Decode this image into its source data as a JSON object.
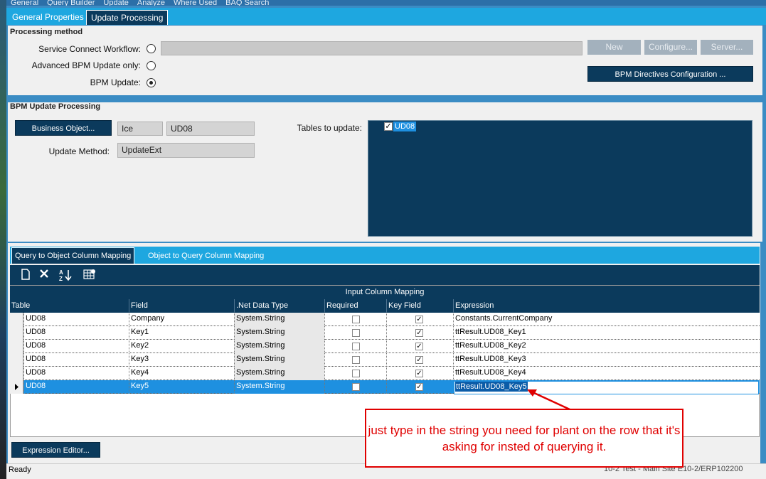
{
  "top_menu": [
    "General",
    "Query Builder",
    "Update",
    "Analyze",
    "Where Used",
    "BAQ Search"
  ],
  "tabs": [
    {
      "label": "General Properties",
      "active": false
    },
    {
      "label": "Update  Processing",
      "active": true
    }
  ],
  "processing_method": {
    "title": "Processing method",
    "options": [
      {
        "label": "Service Connect Workflow:",
        "selected": false
      },
      {
        "label": "Advanced BPM Update only:",
        "selected": false
      },
      {
        "label": "BPM Update:",
        "selected": true
      }
    ],
    "workflow_value": "",
    "buttons": {
      "new": "New",
      "configure": "Configure...",
      "server": "Server..."
    },
    "bpm_directives_button": "BPM Directives Configuration ..."
  },
  "bpm_update_processing": {
    "title": "BPM Update Processing",
    "business_object_button": "Business Object...",
    "bo_system": "Ice",
    "bo_name": "UD08",
    "update_method_label": "Update Method:",
    "update_method_value": "UpdateExt",
    "tables_label": "Tables to update:",
    "tables": [
      {
        "name": "UD08",
        "checked": true
      }
    ]
  },
  "mapping_tabs": [
    {
      "label": "Query to Object Column Mapping",
      "active": true
    },
    {
      "label": "Object to Query Column Mapping",
      "active": false
    }
  ],
  "toolbar_icons": [
    "new-icon",
    "delete-icon",
    "sort-icon",
    "grid-settings-icon"
  ],
  "grid": {
    "title": "Input Column Mapping",
    "columns": [
      "Table",
      "Field",
      ".Net Data Type",
      "Required",
      "Key Field",
      "Expression"
    ],
    "rows": [
      {
        "table": "UD08",
        "field": "Company",
        "type": "System.String",
        "required": false,
        "key": true,
        "expression": "Constants.CurrentCompany",
        "selected": false
      },
      {
        "table": "UD08",
        "field": "Key1",
        "type": "System.String",
        "required": false,
        "key": true,
        "expression": "ttResult.UD08_Key1",
        "selected": false
      },
      {
        "table": "UD08",
        "field": "Key2",
        "type": "System.String",
        "required": false,
        "key": true,
        "expression": "ttResult.UD08_Key2",
        "selected": false
      },
      {
        "table": "UD08",
        "field": "Key3",
        "type": "System.String",
        "required": false,
        "key": true,
        "expression": "ttResult.UD08_Key3",
        "selected": false
      },
      {
        "table": "UD08",
        "field": "Key4",
        "type": "System.String",
        "required": false,
        "key": true,
        "expression": "ttResult.UD08_Key4",
        "selected": false
      },
      {
        "table": "UD08",
        "field": "Key5",
        "type": "System.String",
        "required": false,
        "key": true,
        "expression": "ttResult.UD08_Key5",
        "selected": true
      }
    ]
  },
  "expression_editor_button": "Expression Editor...",
  "status": {
    "left": "Ready",
    "right": "10-2 Test - Main Site   E10-2/ERP102200"
  },
  "annotation": "just type in the string you need for plant on the row that it's asking for insted of querying it.",
  "colors": {
    "accent": "#1ea7e0",
    "dark": "#0b3a5c",
    "selection": "#1e90e0",
    "callout": "#e00000"
  }
}
